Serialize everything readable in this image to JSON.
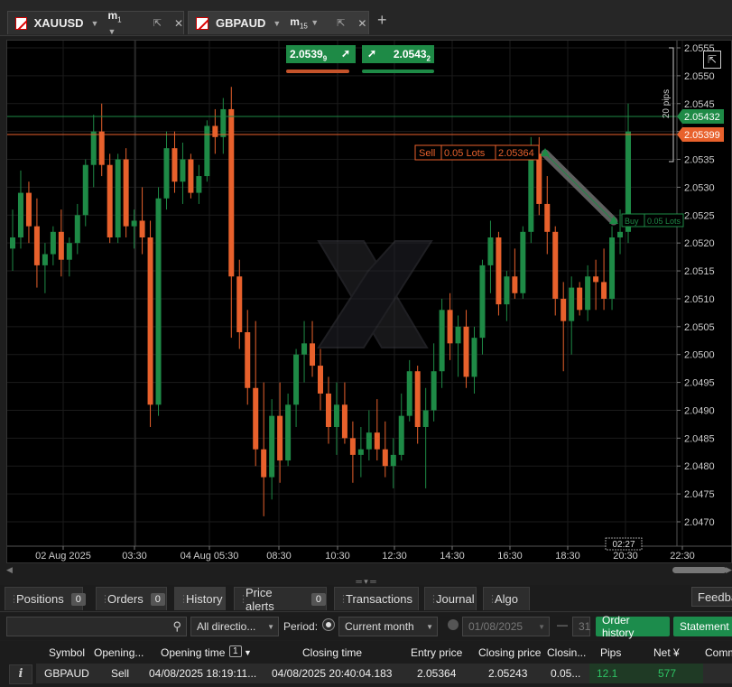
{
  "tabs": [
    {
      "symbol": "XAUUSD",
      "timeframe": "m",
      "timeframe_sub": "1",
      "active": false
    },
    {
      "symbol": "GBPAUD",
      "timeframe": "m",
      "timeframe_sub": "15",
      "active": true
    }
  ],
  "add_tab": "+",
  "quote": {
    "sell": "2.0539",
    "sell_sup": "9",
    "buy": "2.0543",
    "buy_sup": "2"
  },
  "chart_data": {
    "type": "candlestick",
    "symbol": "GBPAUD",
    "y_ticks": [
      "2.0555",
      "2.0550",
      "2.0545",
      "2.0540",
      "2.0535",
      "2.0530",
      "2.0525",
      "2.0520",
      "2.0515",
      "2.0510",
      "2.0505",
      "2.0500",
      "2.0495",
      "2.0490",
      "2.0485",
      "2.0480",
      "2.0475",
      "2.0470"
    ],
    "x_ticks": [
      "02 Aug 2025",
      "03:30",
      "04 Aug 05:30",
      "08:30",
      "10:30",
      "12:30",
      "14:30",
      "16:30",
      "18:30",
      "20:30",
      "22:30"
    ],
    "ask_price": "2.05432",
    "bid_price": "2.05399",
    "pips_label": "20 pips",
    "countdown": "02:27",
    "trade_sell_label": "Sell",
    "trade_sell_lots": "0.05 Lots",
    "trade_sell_price": "2.05364",
    "trade_buy_label": "Buy",
    "trade_buy_lots": "0.05 Lots",
    "candles": [
      [
        2.0519,
        2.0526,
        2.0515,
        2.0521
      ],
      [
        2.0521,
        2.0533,
        2.0519,
        2.0529
      ],
      [
        2.0529,
        2.0531,
        2.052,
        2.0523
      ],
      [
        2.0523,
        2.0528,
        2.0512,
        2.0516
      ],
      [
        2.0516,
        2.052,
        2.0511,
        2.0518
      ],
      [
        2.0518,
        2.0523,
        2.0516,
        2.0522
      ],
      [
        2.0522,
        2.0526,
        2.0514,
        2.0517
      ],
      [
        2.0517,
        2.0521,
        2.0514,
        2.052
      ],
      [
        2.052,
        2.0527,
        2.0518,
        2.0525
      ],
      [
        2.0525,
        2.0535,
        2.0523,
        2.0534
      ],
      [
        2.0534,
        2.0543,
        2.053,
        2.054
      ],
      [
        2.054,
        2.0545,
        2.0532,
        2.0534
      ],
      [
        2.0534,
        2.0536,
        2.052,
        2.0521
      ],
      [
        2.0521,
        2.0536,
        2.052,
        2.0535
      ],
      [
        2.0535,
        2.0537,
        2.0521,
        2.0523
      ],
      [
        2.0523,
        2.0526,
        2.0519,
        2.0524
      ],
      [
        2.0524,
        2.053,
        2.0518,
        2.0521
      ],
      [
        2.0521,
        2.0524,
        2.0487,
        2.0491
      ],
      [
        2.0491,
        2.053,
        2.0489,
        2.0528
      ],
      [
        2.0528,
        2.054,
        2.0526,
        2.0537
      ],
      [
        2.0537,
        2.054,
        2.0529,
        2.0531
      ],
      [
        2.0531,
        2.0538,
        2.0527,
        2.0535
      ],
      [
        2.0535,
        2.0536,
        2.0528,
        2.0529
      ],
      [
        2.0529,
        2.0534,
        2.0527,
        2.0532
      ],
      [
        2.0532,
        2.0542,
        2.0531,
        2.0541
      ],
      [
        2.0541,
        2.0544,
        2.0536,
        2.0539
      ],
      [
        2.0539,
        2.0546,
        2.0536,
        2.0544
      ],
      [
        2.0544,
        2.0548,
        2.0503,
        2.0514
      ],
      [
        2.0514,
        2.0517,
        2.0501,
        2.0504
      ],
      [
        2.0504,
        2.0508,
        2.0491,
        2.0494
      ],
      [
        2.0494,
        2.0506,
        2.048,
        2.0483
      ],
      [
        2.0483,
        2.0495,
        2.0471,
        2.0478
      ],
      [
        2.0478,
        2.0492,
        2.0474,
        2.0489
      ],
      [
        2.0489,
        2.0495,
        2.0477,
        2.0481
      ],
      [
        2.0481,
        2.0493,
        2.048,
        2.0491
      ],
      [
        2.0491,
        2.0501,
        2.0487,
        2.05
      ],
      [
        2.05,
        2.0506,
        2.0495,
        2.0502
      ],
      [
        2.0502,
        2.0506,
        2.0496,
        2.0498
      ],
      [
        2.0498,
        2.0501,
        2.049,
        2.0493
      ],
      [
        2.0493,
        2.0496,
        2.0484,
        2.0487
      ],
      [
        2.0487,
        2.0495,
        2.0482,
        2.0491
      ],
      [
        2.0491,
        2.0495,
        2.0484,
        2.0485
      ],
      [
        2.0485,
        2.0488,
        2.0477,
        2.0482
      ],
      [
        2.0482,
        2.0487,
        2.0478,
        2.0483
      ],
      [
        2.0483,
        2.049,
        2.0481,
        2.0486
      ],
      [
        2.0486,
        2.0492,
        2.0481,
        2.0483
      ],
      [
        2.0483,
        2.0488,
        2.0478,
        2.048
      ],
      [
        2.048,
        2.0485,
        2.0476,
        2.0482
      ],
      [
        2.0482,
        2.0493,
        2.0481,
        2.0489
      ],
      [
        2.0489,
        2.0499,
        2.0488,
        2.0497
      ],
      [
        2.0497,
        2.0498,
        2.0484,
        2.0487
      ],
      [
        2.0487,
        2.0494,
        2.0476,
        2.049
      ],
      [
        2.049,
        2.0502,
        2.0488,
        2.0497
      ],
      [
        2.0497,
        2.051,
        2.0494,
        2.0508
      ],
      [
        2.0508,
        2.0511,
        2.0499,
        2.0502
      ],
      [
        2.0502,
        2.0507,
        2.0496,
        2.0505
      ],
      [
        2.0505,
        2.0508,
        2.0494,
        2.0496
      ],
      [
        2.0496,
        2.0505,
        2.0493,
        2.0503
      ],
      [
        2.0503,
        2.0517,
        2.05,
        2.0516
      ],
      [
        2.0516,
        2.0524,
        2.0511,
        2.0521
      ],
      [
        2.0521,
        2.0522,
        2.0507,
        2.0509
      ],
      [
        2.0509,
        2.0515,
        2.0506,
        2.0514
      ],
      [
        2.0514,
        2.0519,
        2.051,
        2.0511
      ],
      [
        2.0511,
        2.0523,
        2.051,
        2.0522
      ],
      [
        2.0522,
        2.0539,
        2.052,
        2.0536
      ],
      [
        2.0536,
        2.0539,
        2.0525,
        2.0527
      ],
      [
        2.0527,
        2.0532,
        2.0518,
        2.0522
      ],
      [
        2.0522,
        2.0523,
        2.0507,
        2.051
      ],
      [
        2.051,
        2.0513,
        2.0497,
        2.0506
      ],
      [
        2.0506,
        2.0514,
        2.05,
        2.0512
      ],
      [
        2.0512,
        2.0513,
        2.0507,
        2.0508
      ],
      [
        2.0508,
        2.0516,
        2.0506,
        2.0514
      ],
      [
        2.0514,
        2.0517,
        2.0508,
        2.0513
      ],
      [
        2.0513,
        2.0519,
        2.0508,
        2.051
      ],
      [
        2.051,
        2.0523,
        2.0508,
        2.0521
      ],
      [
        2.0521,
        2.0526,
        2.0518,
        2.0522
      ],
      [
        2.0522,
        2.0545,
        2.052,
        2.054
      ]
    ]
  },
  "bottom_tabs": [
    {
      "label": "Positions",
      "badge": "0"
    },
    {
      "label": "Orders",
      "badge": "0"
    },
    {
      "label": "History",
      "badge": ""
    },
    {
      "label": "Price alerts",
      "badge": "0"
    },
    {
      "label": "Transactions",
      "badge": ""
    },
    {
      "label": "Journal",
      "badge": ""
    },
    {
      "label": "Algo",
      "badge": ""
    }
  ],
  "feedback": "Feedback",
  "filters": {
    "search_placeholder": "",
    "direction": "All directio...",
    "period_label": "Period:",
    "period_value": "Current month",
    "date_from": "01/08/2025",
    "date_dash": "—",
    "date_to": "31",
    "order_history": "Order history",
    "statement": "Statement"
  },
  "table": {
    "headers": [
      "Symbol",
      "Opening...",
      "Opening time",
      "1",
      "Closing time",
      "Entry price",
      "Closing price",
      "Closin...",
      "Pips",
      "Net ¥",
      "Comm"
    ],
    "row": [
      "GBPAUD",
      "Sell",
      "04/08/2025 18:19:11...",
      "04/08/2025 20:40:04.183",
      "2.05364",
      "2.05243",
      "0.05...",
      "12.1",
      "577"
    ]
  },
  "colors": {
    "up": "#1e8a46",
    "down": "#e8612c",
    "ask": "#1e8a46",
    "bid": "#e8612c"
  }
}
